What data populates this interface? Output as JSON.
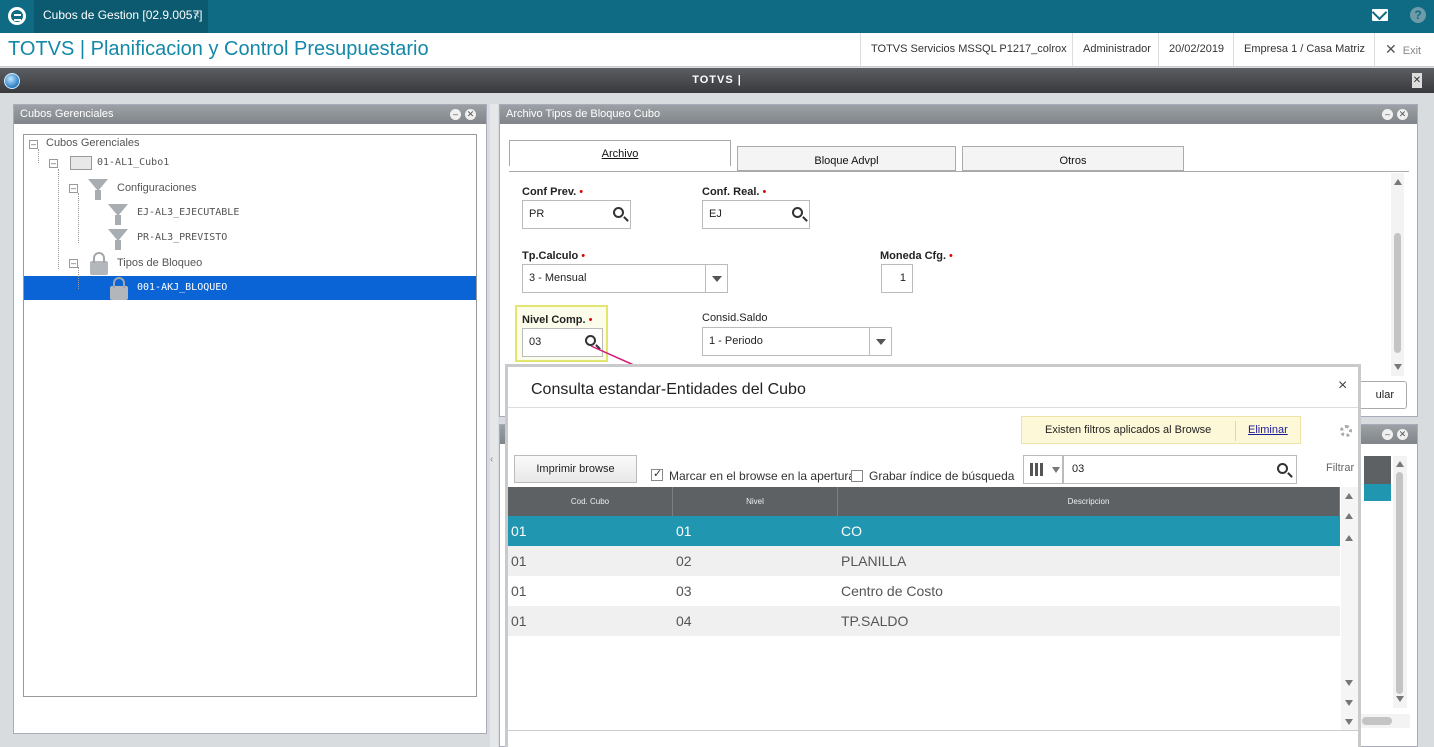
{
  "window": {
    "tab_title": "Cubos de Gestion [02.9.0057]",
    "tab_close": "×"
  },
  "header": {
    "app_title": "TOTVS | Planificacion y Control Presupuestario",
    "environment": "TOTVS Servicios MSSQL P1217_colrox",
    "user": "Administrador",
    "date": "20/02/2019",
    "company": "Empresa 1 / Casa Matriz",
    "exit_label": "Exit"
  },
  "darkbar": {
    "title": "TOTVS |"
  },
  "left_panel": {
    "title": "Cubos Gerenciales",
    "tree": [
      {
        "label": "Cubos Gerenciales",
        "level": 0,
        "icon": "none"
      },
      {
        "label": "01-AL1_Cubo1",
        "level": 1,
        "icon": "folder-icon"
      },
      {
        "label": "Configuraciones",
        "level": 2,
        "icon": "funnel-icon"
      },
      {
        "label": "EJ-AL3_EJECUTABLE",
        "level": 3,
        "icon": "funnel-icon"
      },
      {
        "label": "PR-AL3_PREVISTO",
        "level": 3,
        "icon": "funnel-icon"
      },
      {
        "label": "Tipos de Bloqueo",
        "level": 2,
        "icon": "lock-icon"
      },
      {
        "label": "001-AKJ_BLOQUEO",
        "level": 3,
        "icon": "lock-icon",
        "selected": true
      }
    ]
  },
  "right_panel": {
    "title": "Archivo Tipos de Bloqueo Cubo",
    "tabs": [
      "Archivo",
      "Bloque Advpl",
      "Otros"
    ],
    "active_tab": "Archivo",
    "fields": {
      "conf_prev": {
        "label": "Conf Prev.",
        "value": "PR",
        "required": "•"
      },
      "conf_real": {
        "label": "Conf. Real.",
        "value": "EJ",
        "required": "•"
      },
      "tp_calculo": {
        "label": "Tp.Calculo",
        "value": "3 - Mensual",
        "required": "•"
      },
      "moneda_cfg": {
        "label": "Moneda Cfg.",
        "value": "1",
        "required": "•"
      },
      "nivel_comp": {
        "label": "Nivel Comp.",
        "value": "03",
        "required": "•"
      },
      "consid_saldo": {
        "label": "Consid.Saldo",
        "value": "1 - Periodo"
      }
    },
    "partial_button": "ular"
  },
  "dialog": {
    "title": "Consulta estandar-Entidades del Cubo",
    "close": "×",
    "filter_notice": "Existen filtros aplicados al Browse",
    "filter_remove": "Eliminar",
    "print_button": "Imprimir browse",
    "checkbox_mark": {
      "label": "Marcar en el browse en la apertura",
      "checked": true
    },
    "checkbox_index": {
      "label": "Grabar índice de búsqueda",
      "checked": false
    },
    "search_value": "03",
    "filter_label": "Filtrar",
    "columns": [
      "Cod. Cubo",
      "Nivel",
      "Descripcion"
    ],
    "rows": [
      [
        "01",
        "01",
        "CO"
      ],
      [
        "01",
        "02",
        "PLANILLA"
      ],
      [
        "01",
        "03",
        "Centro de Costo"
      ],
      [
        "01",
        "04",
        "TP.SALDO"
      ]
    ],
    "selected_row": 0
  },
  "colors": {
    "topbar": "#0f6b84",
    "title_blue": "#1488a8",
    "selection_blue": "#0a64d6",
    "grid_selected": "#2196b0",
    "highlight_yellow": "#e6e87a",
    "arrow_magenta": "#d4197a"
  }
}
